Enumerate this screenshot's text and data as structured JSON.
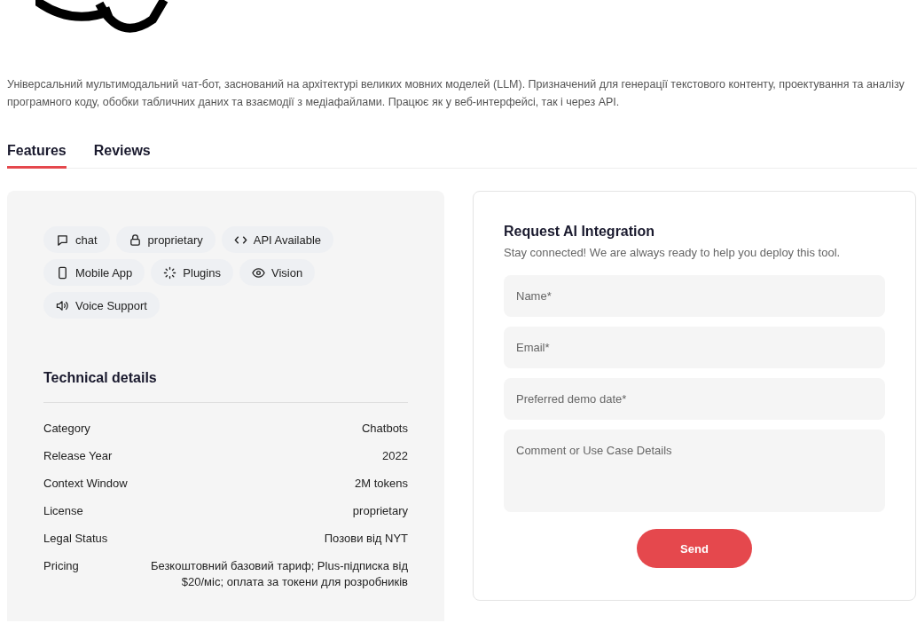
{
  "description": "Універсальний мультимодальний чат-бот, заснований на архітектурі великих мовних моделей (LLM). Призначений для генерації текстового контенту, проектування та аналізу програмного коду, обобки табличних даних та взаємодії з медіафайлами. Працює як у веб-интерфейсі, так і через API.",
  "tabs": [
    {
      "label": "Features",
      "selected": true
    },
    {
      "label": "Reviews",
      "selected": false
    }
  ],
  "features": [
    {
      "kind": "chat",
      "label": "chat"
    },
    {
      "kind": "lock",
      "label": "proprietary"
    },
    {
      "kind": "code",
      "label": "API Available"
    },
    {
      "kind": "mobile",
      "label": "Mobile App"
    },
    {
      "kind": "plugins",
      "label": "Plugins"
    },
    {
      "kind": "eye",
      "label": "Vision"
    },
    {
      "kind": "speaker",
      "label": "Voice Support"
    }
  ],
  "technical_details": {
    "title": "Technical details",
    "rows": [
      {
        "label": "Category",
        "value": "Chatbots"
      },
      {
        "label": "Release Year",
        "value": "2022"
      },
      {
        "label": "Context Window",
        "value": "2M tokens"
      },
      {
        "label": "License",
        "value": "proprietary"
      },
      {
        "label": "Legal Status",
        "value": "Позови від NYT"
      },
      {
        "label": "Pricing",
        "value": "Безкоштовний базовий тариф; Plus-підписка від $20/міс; оплата за токени для розробників"
      }
    ]
  },
  "request_form": {
    "title": "Request AI Integration",
    "subtitle": "Stay connected! We are always ready to help you deploy this tool.",
    "fields": [
      {
        "kind": "input",
        "placeholder": "Name*"
      },
      {
        "kind": "input",
        "placeholder": "Email*"
      },
      {
        "kind": "input",
        "placeholder": "Preferred demo date*"
      },
      {
        "kind": "textarea",
        "placeholder": "Comment or Use Case Details"
      }
    ],
    "button": "Send"
  }
}
